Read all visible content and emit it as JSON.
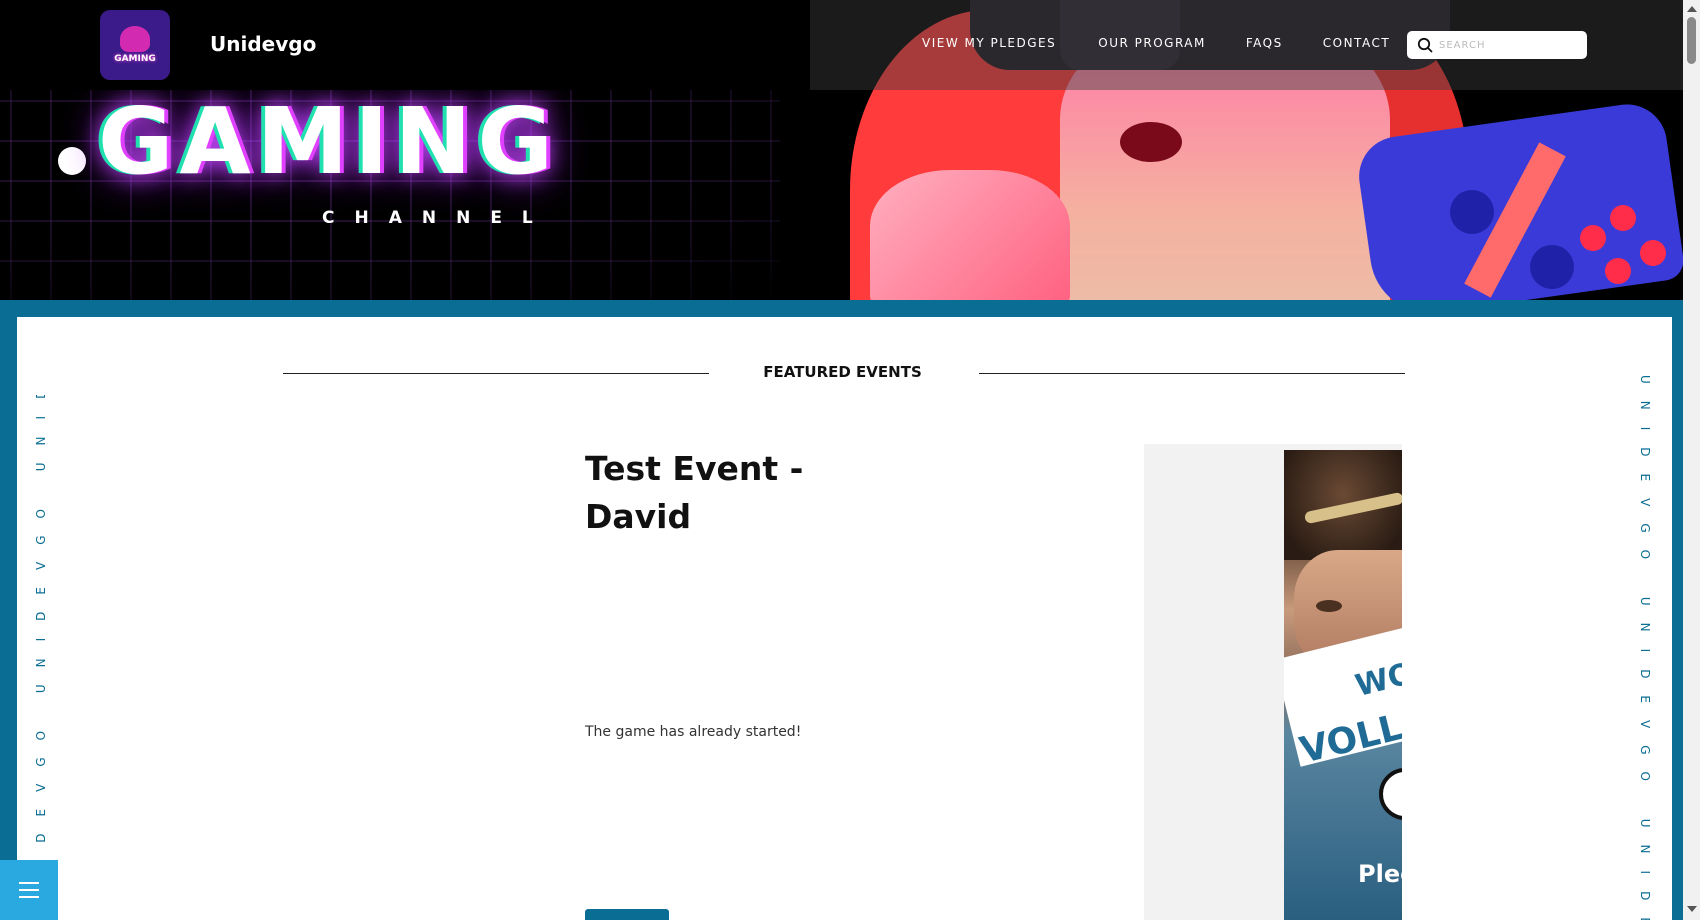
{
  "header": {
    "site_name": "Unidevgo",
    "logo_text": "GAMING",
    "nav": [
      {
        "label": "VIEW MY PLEDGES"
      },
      {
        "label": "OUR PROGRAM"
      },
      {
        "label": "FAQS"
      },
      {
        "label": "CONTACT"
      }
    ],
    "search": {
      "placeholder": "SEARCH",
      "value": ""
    }
  },
  "hero": {
    "headline": "GAMING",
    "subheadline": "CHANNEL"
  },
  "side_text": {
    "left": "UNIDEVGO UNIDEVGO UNIDEVGO",
    "right": "UNIDEVGO UNIDEVGO UNIDEVGO"
  },
  "featured": {
    "section_title": "FEATURED EVENTS",
    "event": {
      "title": "Test Event - David",
      "status": "The game has already started!",
      "image_text": {
        "line1": "WO",
        "line2": "VOLL",
        "line3": "Plec"
      }
    }
  },
  "icons": {
    "search": "search-icon",
    "menu": "hamburger-menu-icon"
  },
  "colors": {
    "accent": "#0a6d93",
    "menu_button": "#2aa9e0",
    "glow_pink": "#e040ff",
    "glow_green": "#20e0b0"
  }
}
